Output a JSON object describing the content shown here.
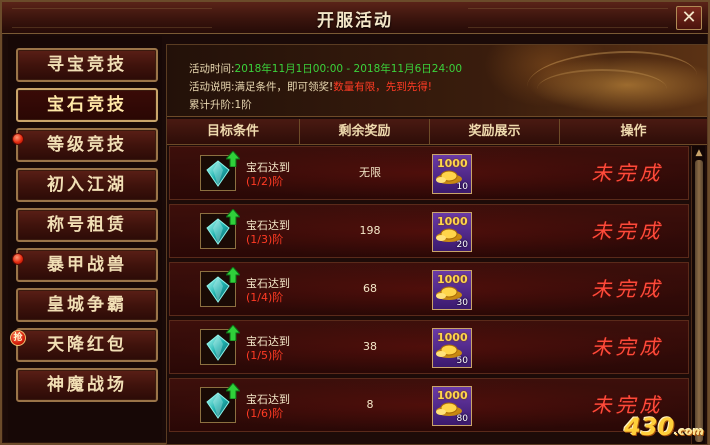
{
  "window": {
    "title": "开服活动",
    "close_label": "✕"
  },
  "sidebar": {
    "items": [
      {
        "label": "寻宝竞技",
        "active": false,
        "badge": ""
      },
      {
        "label": "宝石竞技",
        "active": true,
        "badge": ""
      },
      {
        "label": "等级竞技",
        "active": false,
        "badge": "dot"
      },
      {
        "label": "初入江湖",
        "active": false,
        "badge": ""
      },
      {
        "label": "称号租赁",
        "active": false,
        "badge": ""
      },
      {
        "label": "暴甲战兽",
        "active": false,
        "badge": "dot"
      },
      {
        "label": "皇城争霸",
        "active": false,
        "badge": ""
      },
      {
        "label": "天降红包",
        "active": false,
        "badge": "抢"
      },
      {
        "label": "神魔战场",
        "active": false,
        "badge": ""
      }
    ]
  },
  "info": {
    "time_label": "活动时间:",
    "time_value": "2018年11月1日00:00 - 2018年11月6日24:00",
    "desc_label": "活动说明:",
    "desc_text": "满足条件，即可领奖!",
    "desc_highlight": "数量有限，先到先得!",
    "progress_label": "累计升阶:",
    "progress_value": "1阶"
  },
  "table": {
    "headers": [
      "目标条件",
      "剩余奖励",
      "奖励展示",
      "操作"
    ],
    "rows": [
      {
        "target": "宝石达到",
        "level": "(1/2)阶",
        "remaining": "无限",
        "reward_gold": "1000",
        "reward_count": "10",
        "status": "未完成"
      },
      {
        "target": "宝石达到",
        "level": "(1/3)阶",
        "remaining": "198",
        "reward_gold": "1000",
        "reward_count": "20",
        "status": "未完成"
      },
      {
        "target": "宝石达到",
        "level": "(1/4)阶",
        "remaining": "68",
        "reward_gold": "1000",
        "reward_count": "30",
        "status": "未完成"
      },
      {
        "target": "宝石达到",
        "level": "(1/5)阶",
        "remaining": "38",
        "reward_gold": "1000",
        "reward_count": "50",
        "status": "未完成"
      },
      {
        "target": "宝石达到",
        "level": "(1/6)阶",
        "remaining": "8",
        "reward_gold": "1000",
        "reward_count": "80",
        "status": "未完成"
      }
    ]
  },
  "icons": {
    "gem": "gem-icon",
    "arrow": "green-up-arrow-icon",
    "reward": "gold-ingot-icon"
  },
  "watermark": {
    "text": "430",
    "suffix": ".com"
  }
}
